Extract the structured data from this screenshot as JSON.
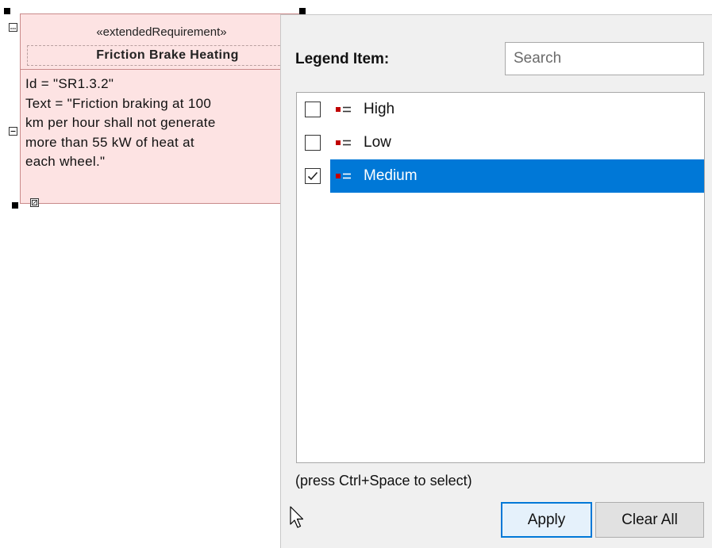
{
  "requirement": {
    "stereotype": "«extendedRequirement»",
    "name": "Friction Brake Heating",
    "properties": [
      "Id = \"SR1.3.2\"",
      "Text = \"Friction braking at 100",
      "km per hour shall not generate",
      "more than 55 kW of heat at",
      "each wheel.\""
    ],
    "fill_color": "#fde3e3",
    "border_color": "#c98a8a"
  },
  "legend_popup": {
    "label": "Legend Item:",
    "search": {
      "placeholder": "Search",
      "value": ""
    },
    "items": [
      {
        "label": "High",
        "checked": false,
        "selected": false
      },
      {
        "label": "Low",
        "checked": false,
        "selected": false
      },
      {
        "label": "Medium",
        "checked": true,
        "selected": true
      }
    ],
    "legend_icon": "legend-item-icon",
    "hint": "(press Ctrl+Space to select)",
    "apply_label": "Apply",
    "clear_all_label": "Clear All",
    "selection_color": "#0078d7",
    "legend_marker_color": "#c00000"
  }
}
